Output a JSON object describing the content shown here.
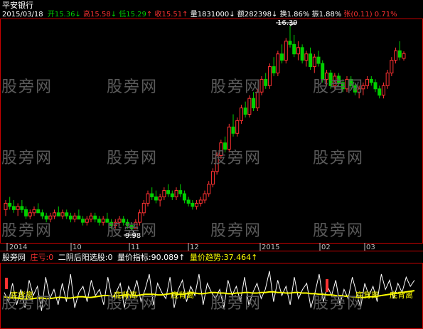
{
  "title": "平安银行",
  "quote": {
    "date": "2015/03/18",
    "open_label": "开",
    "open": "15.36",
    "open_arrow": "↓",
    "high_label": "高",
    "high": "15.58",
    "high_arrow": "↓",
    "low_label": "低",
    "low": "15.29",
    "low_arrow": "↑",
    "close_label": "收",
    "close": "15.51",
    "close_arrow": "↑",
    "vol_label": "量",
    "vol": "1831000",
    "vol_arrow": "↓",
    "amt_label": "额",
    "amt": "282398",
    "amt_arrow": "↓",
    "turn_label": "换",
    "turn": "1.86%",
    "amp_label": "振",
    "amp": "1.88%",
    "chg_label": "张",
    "chg": "(0.11)",
    "chg_pct": "0.71%"
  },
  "price_labels": {
    "high": "16.39",
    "low": "9.98"
  },
  "xaxis": [
    "2014",
    "10",
    "11",
    "12",
    "2015",
    "02",
    "03"
  ],
  "indicator": {
    "name": "股旁网",
    "l1_label": "庄亏:",
    "l1_value": "0",
    "l2_label": "二阴后阳选股:",
    "l2_value": "0",
    "l3_label": "量价指标:",
    "l3_value": "90.089",
    "l3_arrow": "↑",
    "l4_label": "量价趋势:",
    "l4_value": "37.464",
    "l4_arrow": "↑"
  },
  "signals": [
    "底背离",
    "底背离",
    "底背离",
    "底背离",
    "底背离"
  ],
  "watermark": "股旁网",
  "colors": {
    "up": "#ff3232",
    "down": "#00d000",
    "white": "#ffffff",
    "yellow": "#ffff00",
    "border": "#c80000",
    "axis": "#c0c0c0",
    "watermark": "#5a5a5a"
  },
  "chart_data": {
    "type": "candlestick",
    "y_range": [
      9.98,
      16.39
    ],
    "candles": [
      [
        10.6,
        10.9,
        10.4,
        10.8
      ],
      [
        10.8,
        11.0,
        10.6,
        10.7
      ],
      [
        10.7,
        10.9,
        10.5,
        10.6
      ],
      [
        10.6,
        10.8,
        10.4,
        10.7
      ],
      [
        10.7,
        10.9,
        10.5,
        10.6
      ],
      [
        10.6,
        10.7,
        10.3,
        10.4
      ],
      [
        10.4,
        10.6,
        10.3,
        10.5
      ],
      [
        10.5,
        10.7,
        10.4,
        10.6
      ],
      [
        10.6,
        10.8,
        10.5,
        10.5
      ],
      [
        10.5,
        10.6,
        10.3,
        10.4
      ],
      [
        10.4,
        10.5,
        10.2,
        10.3
      ],
      [
        10.3,
        10.5,
        10.2,
        10.4
      ],
      [
        10.4,
        10.6,
        10.3,
        10.5
      ],
      [
        10.5,
        10.7,
        10.4,
        10.4
      ],
      [
        10.4,
        10.6,
        10.3,
        10.5
      ],
      [
        10.5,
        10.6,
        10.3,
        10.4
      ],
      [
        10.4,
        10.5,
        10.2,
        10.3
      ],
      [
        10.3,
        10.5,
        10.2,
        10.4
      ],
      [
        10.4,
        10.6,
        10.3,
        10.3
      ],
      [
        10.3,
        10.4,
        10.1,
        10.2
      ],
      [
        10.2,
        10.4,
        10.1,
        10.3
      ],
      [
        10.3,
        10.5,
        10.2,
        10.4
      ],
      [
        10.4,
        10.5,
        10.2,
        10.3
      ],
      [
        10.3,
        10.4,
        10.1,
        10.2
      ],
      [
        10.2,
        10.4,
        10.1,
        10.3
      ],
      [
        10.3,
        10.5,
        10.2,
        10.2
      ],
      [
        10.2,
        10.3,
        10.0,
        10.1
      ],
      [
        10.1,
        10.3,
        10.0,
        10.2
      ],
      [
        10.2,
        10.4,
        10.1,
        10.3
      ],
      [
        10.3,
        10.4,
        10.1,
        10.2
      ],
      [
        10.2,
        10.3,
        10.0,
        10.1
      ],
      [
        10.1,
        10.2,
        9.98,
        10.0
      ],
      [
        10.0,
        10.3,
        9.98,
        10.2
      ],
      [
        10.2,
        10.6,
        10.1,
        10.5
      ],
      [
        10.5,
        10.9,
        10.4,
        10.8
      ],
      [
        10.8,
        11.2,
        10.7,
        11.1
      ],
      [
        11.1,
        11.3,
        10.9,
        11.0
      ],
      [
        11.0,
        11.2,
        10.8,
        10.9
      ],
      [
        10.9,
        11.1,
        10.7,
        11.0
      ],
      [
        11.0,
        11.3,
        10.9,
        11.2
      ],
      [
        11.2,
        11.4,
        11.0,
        11.1
      ],
      [
        11.1,
        11.2,
        10.9,
        11.0
      ],
      [
        11.0,
        11.3,
        10.9,
        11.2
      ],
      [
        11.2,
        11.4,
        11.0,
        11.1
      ],
      [
        11.1,
        11.2,
        10.8,
        10.9
      ],
      [
        10.9,
        11.0,
        10.7,
        10.8
      ],
      [
        10.8,
        10.9,
        10.6,
        10.7
      ],
      [
        10.7,
        10.9,
        10.6,
        10.8
      ],
      [
        10.8,
        11.0,
        10.7,
        10.9
      ],
      [
        10.9,
        11.2,
        10.8,
        11.1
      ],
      [
        11.1,
        11.5,
        11.0,
        11.4
      ],
      [
        11.4,
        11.9,
        11.3,
        11.8
      ],
      [
        11.8,
        12.4,
        11.7,
        12.3
      ],
      [
        12.3,
        12.8,
        12.2,
        12.7
      ],
      [
        12.7,
        12.9,
        12.4,
        12.5
      ],
      [
        12.5,
        13.3,
        12.4,
        13.2
      ],
      [
        13.2,
        13.6,
        12.9,
        13.0
      ],
      [
        13.0,
        13.5,
        12.9,
        13.4
      ],
      [
        13.4,
        13.9,
        13.3,
        13.8
      ],
      [
        13.8,
        14.0,
        13.5,
        13.6
      ],
      [
        13.6,
        14.2,
        13.5,
        14.1
      ],
      [
        14.1,
        14.3,
        13.7,
        13.8
      ],
      [
        13.8,
        14.4,
        13.7,
        14.3
      ],
      [
        14.3,
        14.8,
        14.2,
        14.7
      ],
      [
        14.7,
        14.9,
        14.4,
        14.5
      ],
      [
        14.5,
        15.2,
        14.4,
        15.1
      ],
      [
        15.1,
        15.4,
        14.8,
        14.9
      ],
      [
        14.9,
        15.6,
        14.8,
        15.5
      ],
      [
        15.5,
        15.8,
        15.2,
        15.3
      ],
      [
        15.3,
        16.0,
        15.2,
        15.9
      ],
      [
        15.9,
        16.39,
        15.7,
        15.8
      ],
      [
        15.8,
        16.1,
        15.4,
        15.5
      ],
      [
        15.5,
        15.9,
        15.3,
        15.7
      ],
      [
        15.7,
        15.8,
        15.2,
        15.3
      ],
      [
        15.3,
        15.6,
        15.1,
        15.5
      ],
      [
        15.5,
        15.7,
        15.0,
        15.1
      ],
      [
        15.1,
        15.5,
        14.9,
        15.4
      ],
      [
        15.4,
        15.6,
        15.1,
        15.2
      ],
      [
        15.2,
        15.3,
        14.6,
        14.7
      ],
      [
        14.7,
        15.0,
        14.5,
        14.9
      ],
      [
        14.9,
        15.0,
        14.4,
        14.5
      ],
      [
        14.5,
        14.9,
        14.4,
        14.8
      ],
      [
        14.8,
        14.9,
        14.5,
        14.6
      ],
      [
        14.6,
        14.7,
        14.3,
        14.4
      ],
      [
        14.4,
        14.8,
        14.3,
        14.7
      ],
      [
        14.7,
        14.8,
        14.4,
        14.5
      ],
      [
        14.5,
        14.6,
        14.2,
        14.3
      ],
      [
        14.3,
        14.5,
        14.1,
        14.4
      ],
      [
        14.4,
        14.6,
        14.2,
        14.5
      ],
      [
        14.5,
        14.8,
        14.4,
        14.7
      ],
      [
        14.7,
        14.8,
        14.5,
        14.6
      ],
      [
        14.6,
        14.7,
        14.3,
        14.4
      ],
      [
        14.4,
        14.5,
        14.1,
        14.2
      ],
      [
        14.2,
        14.6,
        14.1,
        14.5
      ],
      [
        14.5,
        15.0,
        14.4,
        14.9
      ],
      [
        14.9,
        15.4,
        14.8,
        15.3
      ],
      [
        15.3,
        15.7,
        15.2,
        15.6
      ],
      [
        15.6,
        15.9,
        15.3,
        15.4
      ],
      [
        15.36,
        15.58,
        15.29,
        15.51
      ]
    ],
    "indicator_white": [
      55,
      40,
      70,
      35,
      60,
      30,
      75,
      50,
      65,
      25,
      80,
      45,
      60,
      35,
      70,
      40,
      85,
      30,
      55,
      65,
      40,
      75,
      50,
      60,
      35,
      80,
      45,
      55,
      70,
      30,
      65,
      50,
      75,
      40,
      60,
      85,
      35,
      70,
      55,
      45,
      80,
      30,
      60,
      75,
      40,
      65,
      50,
      85,
      35,
      70,
      55,
      45,
      60,
      30,
      75,
      50,
      65,
      40,
      80,
      35,
      55,
      70,
      45,
      60,
      90,
      40,
      75,
      50,
      65,
      35,
      80,
      45,
      60,
      70,
      30,
      55,
      85,
      40,
      65,
      50,
      75,
      35,
      60,
      45,
      80,
      55,
      30,
      70,
      50,
      65,
      40,
      85,
      60,
      75,
      45,
      70,
      55,
      80,
      65,
      75
    ],
    "indicator_yellow": [
      48,
      47,
      46,
      46,
      45,
      44,
      44,
      45,
      46,
      46,
      45,
      45,
      46,
      47,
      47,
      46,
      46,
      47,
      48,
      48,
      47,
      47,
      48,
      49,
      50,
      50,
      49,
      49,
      50,
      51,
      51,
      50,
      50,
      51,
      52,
      52,
      52,
      51,
      51,
      52,
      53,
      53,
      52,
      52,
      53,
      54,
      54,
      53,
      53,
      54,
      55,
      55,
      54,
      54,
      53,
      53,
      54,
      54,
      55,
      55,
      54,
      54,
      55,
      55,
      56,
      56,
      55,
      55,
      54,
      54,
      55,
      55,
      54,
      54,
      53,
      53,
      52,
      52,
      51,
      51,
      50,
      50,
      49,
      49,
      48,
      48,
      47,
      47,
      48,
      48,
      49,
      50,
      51,
      52,
      53,
      54,
      55,
      56,
      57,
      58
    ],
    "signal_positions": [
      0.03,
      0.27,
      0.41,
      0.84,
      0.93
    ]
  }
}
